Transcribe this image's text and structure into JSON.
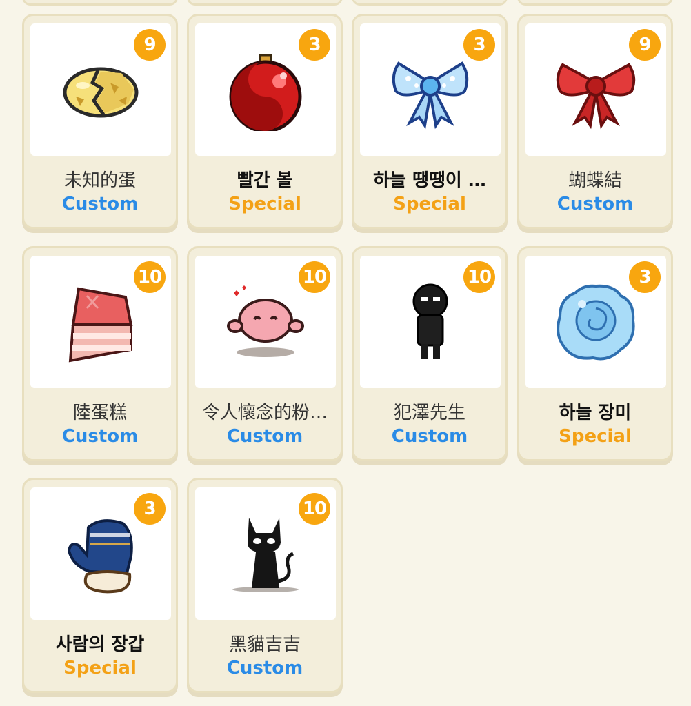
{
  "items": [
    {
      "name": "未知的蛋",
      "type": "Custom",
      "count": "9",
      "icon": "cracked-egg-icon"
    },
    {
      "name": "빨간 볼",
      "type": "Special",
      "count": "3",
      "icon": "red-ornament-ball-icon"
    },
    {
      "name": "하늘 땡땡이 …",
      "type": "Special",
      "count": "3",
      "icon": "blue-polka-bow-icon"
    },
    {
      "name": "蝴蝶結",
      "type": "Custom",
      "count": "9",
      "icon": "red-bow-icon"
    },
    {
      "name": "陸蛋糕",
      "type": "Custom",
      "count": "10",
      "icon": "cake-slice-icon"
    },
    {
      "name": "令人懷念的粉…",
      "type": "Custom",
      "count": "10",
      "icon": "pink-blob-icon"
    },
    {
      "name": "犯澤先生",
      "type": "Custom",
      "count": "10",
      "icon": "black-figure-icon"
    },
    {
      "name": "하늘 장미",
      "type": "Special",
      "count": "3",
      "icon": "blue-rose-icon"
    },
    {
      "name": "사람의 장갑",
      "type": "Special",
      "count": "3",
      "icon": "blue-mitten-icon"
    },
    {
      "name": "黑貓吉吉",
      "type": "Custom",
      "count": "10",
      "icon": "black-cat-icon"
    }
  ],
  "colors": {
    "custom": "#2a8be6",
    "special": "#f3a116",
    "badge": "#f8a60f"
  }
}
